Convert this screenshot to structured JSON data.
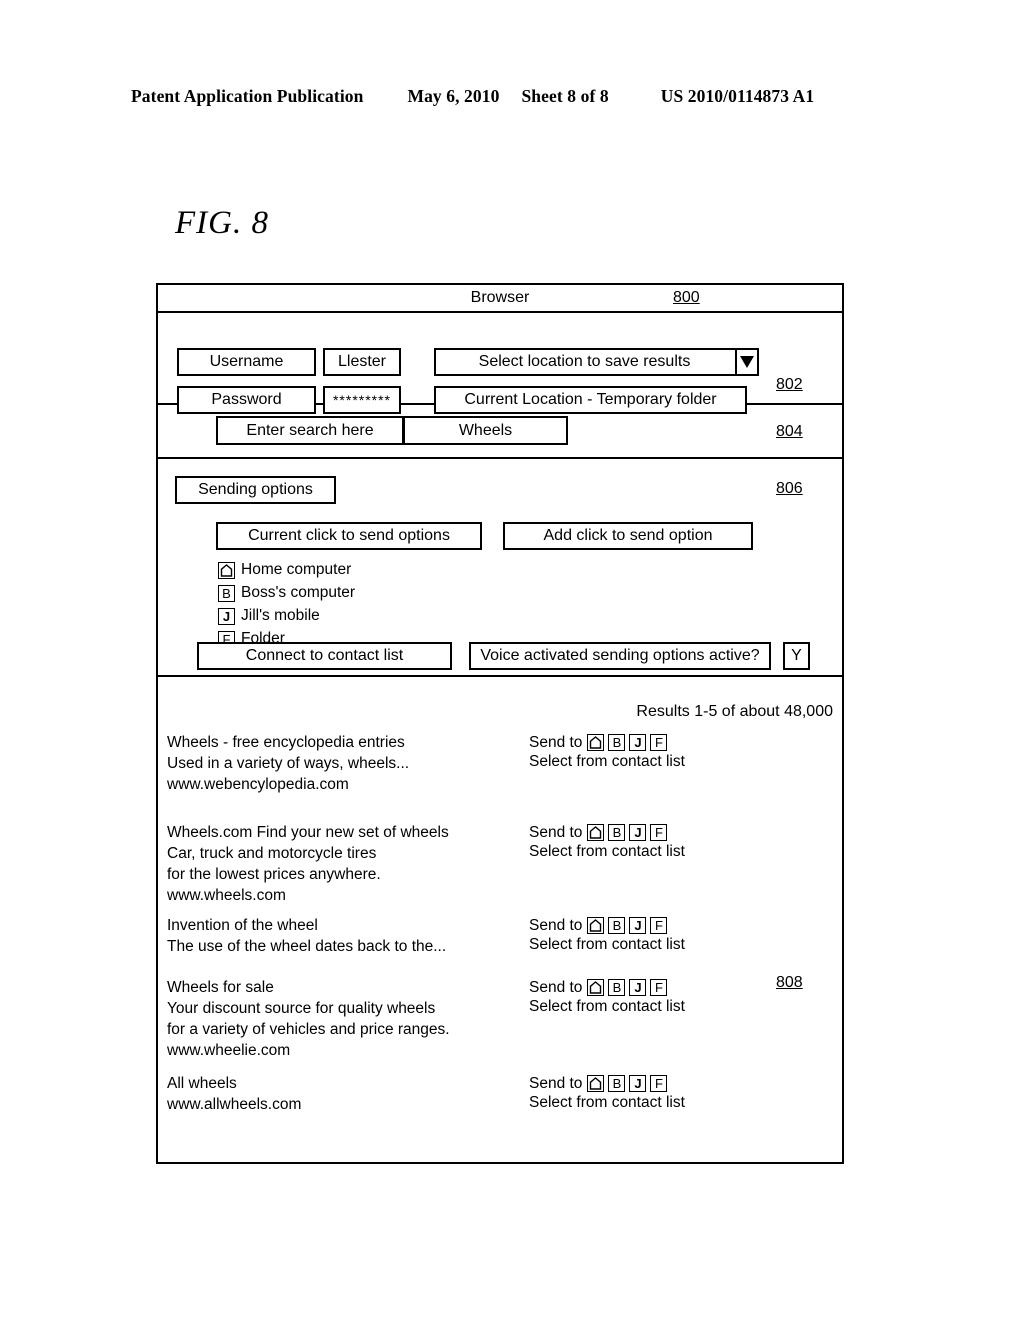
{
  "page_header": {
    "publication": "Patent Application Publication",
    "date": "May 6, 2010",
    "sheet": "Sheet 8 of 8",
    "patent_number": "US 2010/0114873 A1"
  },
  "figure_label": "FIG. 8",
  "browser": {
    "title": "Browser",
    "ref": "800",
    "credentials": {
      "ref": "802",
      "username_label": "Username",
      "username_value": "Llester",
      "password_label": "Password",
      "password_value": "*********",
      "select_location_label": "Select location to save results",
      "dropdown_icon": "triangle-down-icon",
      "current_location_label": "Current Location - Temporary folder"
    },
    "search": {
      "ref": "804",
      "prompt_label": "Enter search here",
      "query_value": "Wheels"
    },
    "sending": {
      "ref": "806",
      "sending_options_label": "Sending options",
      "current_options_label": "Current click to send options",
      "add_option_label": "Add click to send option",
      "options": [
        {
          "glyph": "home-icon",
          "glyph_text": "",
          "label": "Home computer"
        },
        {
          "glyph": "letter-b-icon",
          "glyph_text": "B",
          "label": "Boss's computer"
        },
        {
          "glyph": "letter-j-icon",
          "glyph_text": "J",
          "label": "Jill's mobile"
        },
        {
          "glyph": "letter-f-icon",
          "glyph_text": "F",
          "label": "Folder"
        }
      ],
      "connect_contact_label": "Connect to contact list",
      "voice_question_label": "Voice activated sending options active?",
      "voice_answer_value": "Y"
    },
    "results": {
      "ref": "808",
      "count_text": "Results 1-5 of about 48,000",
      "send_to_label": "Send to",
      "select_contact_label": "Select from contact list",
      "send_glyphs": [
        {
          "glyph": "home-icon",
          "glyph_text": ""
        },
        {
          "glyph": "letter-b-icon",
          "glyph_text": "B"
        },
        {
          "glyph": "letter-j-icon",
          "glyph_text": "J"
        },
        {
          "glyph": "letter-f-icon",
          "glyph_text": "F"
        }
      ],
      "items": [
        {
          "lines": [
            "Wheels - free encyclopedia entries",
            "Used in a variety of ways, wheels...",
            "www.webencylopedia.com"
          ]
        },
        {
          "lines": [
            "Wheels.com Find your new set of wheels",
            "Car, truck and motorcycle tires",
            "for the lowest prices anywhere.",
            "www.wheels.com"
          ]
        },
        {
          "lines": [
            "Invention of the wheel",
            "The use of the wheel dates back to the..."
          ]
        },
        {
          "lines": [
            "Wheels for sale",
            "Your discount source for quality wheels",
            "for a variety of vehicles and price ranges.",
            "www.wheelie.com"
          ]
        },
        {
          "lines": [
            "All wheels",
            "www.allwheels.com"
          ]
        }
      ]
    }
  }
}
